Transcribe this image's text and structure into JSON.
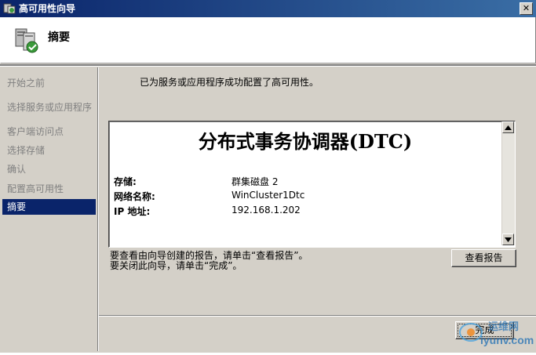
{
  "window": {
    "title": "高可用性向导",
    "close_glyph": "✕"
  },
  "header": {
    "title": "摘要"
  },
  "nav": {
    "items": [
      {
        "label": "开始之前"
      },
      {
        "label": "选择服务或应用程序"
      },
      {
        "label": "客户端访问点"
      },
      {
        "label": "选择存储"
      },
      {
        "label": "确认"
      },
      {
        "label": "配置高可用性"
      },
      {
        "label": "摘要"
      }
    ],
    "active_index": 6
  },
  "main": {
    "success_message": "已为服务或应用程序成功配置了高可用性。",
    "report": {
      "title": "分布式事务协调器(DTC)",
      "rows": [
        {
          "label": "存储:",
          "value": "群集磁盘 2"
        },
        {
          "label": "网络名称:",
          "value": "WinCluster1Dtc"
        },
        {
          "label": "IP 地址:",
          "value": "192.168.1.202"
        }
      ]
    },
    "hint_line1": "要查看由向导创建的报告，请单击“查看报告”。",
    "hint_line2": "要关闭此向导，请单击“完成”。",
    "view_report_label": "查看报告"
  },
  "footer": {
    "finish_label": "完成"
  },
  "watermark": {
    "line1": "运维网",
    "line2": "iyunv.com"
  },
  "colors": {
    "title_bar": "#0a246a",
    "selected_nav": "#0a246a",
    "face": "#d4d0c8"
  }
}
